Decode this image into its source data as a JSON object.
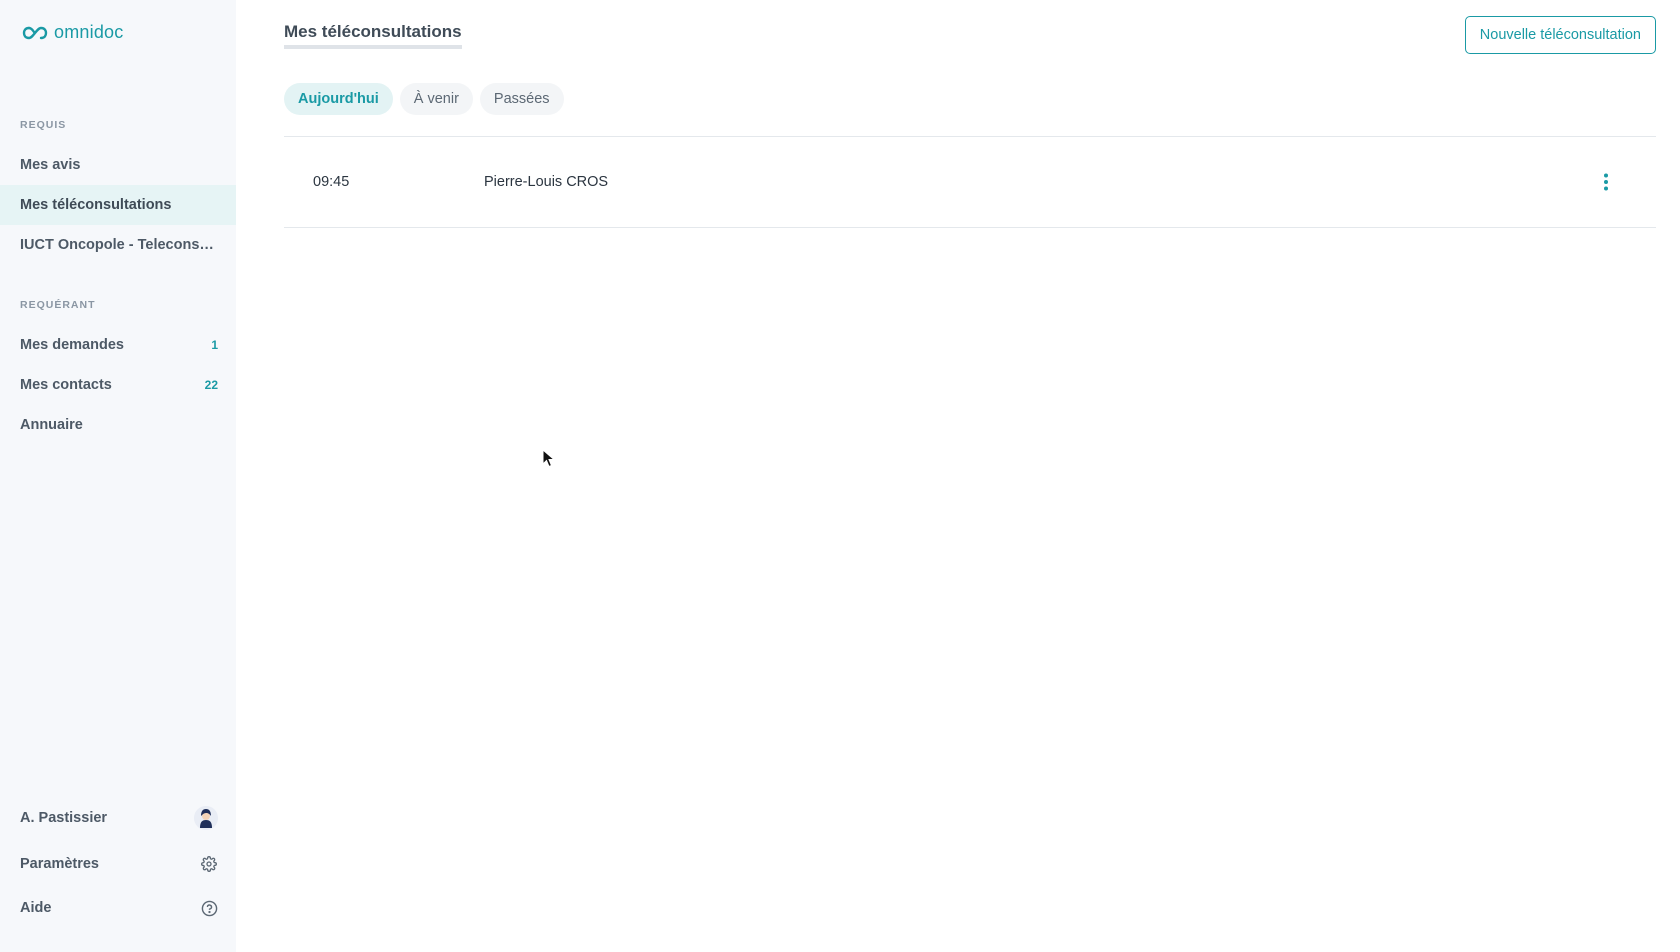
{
  "app": {
    "logo_text": "omnidoc",
    "brand_color": "#1a9aa5"
  },
  "sidebar": {
    "sections": [
      {
        "label": "REQUIS",
        "items": [
          {
            "label": "Mes avis",
            "count": ""
          },
          {
            "label": "Mes téléconsultations",
            "count": "",
            "active": true
          },
          {
            "label": "IUCT Oncopole - Teleconsult...",
            "count": ""
          }
        ]
      },
      {
        "label": "REQUÉRANT",
        "items": [
          {
            "label": "Mes demandes",
            "count": "1"
          },
          {
            "label": "Mes contacts",
            "count": "22"
          },
          {
            "label": "Annuaire",
            "count": ""
          }
        ]
      }
    ],
    "bottom": {
      "user": {
        "label": "A. Pastissier",
        "icon": "avatar"
      },
      "settings": {
        "label": "Paramètres",
        "icon": "gear-icon"
      },
      "help": {
        "label": "Aide",
        "icon": "question-circle-icon"
      }
    }
  },
  "main": {
    "title": "Mes téléconsultations",
    "new_button_label": "Nouvelle téléconsultation",
    "tabs": [
      {
        "label": "Aujourd'hui",
        "active": true
      },
      {
        "label": "À venir",
        "active": false
      },
      {
        "label": "Passées",
        "active": false
      }
    ],
    "rows": [
      {
        "time": "09:45",
        "patient": "Pierre-Louis CROS",
        "menu_icon": "more-vertical-icon"
      }
    ]
  }
}
